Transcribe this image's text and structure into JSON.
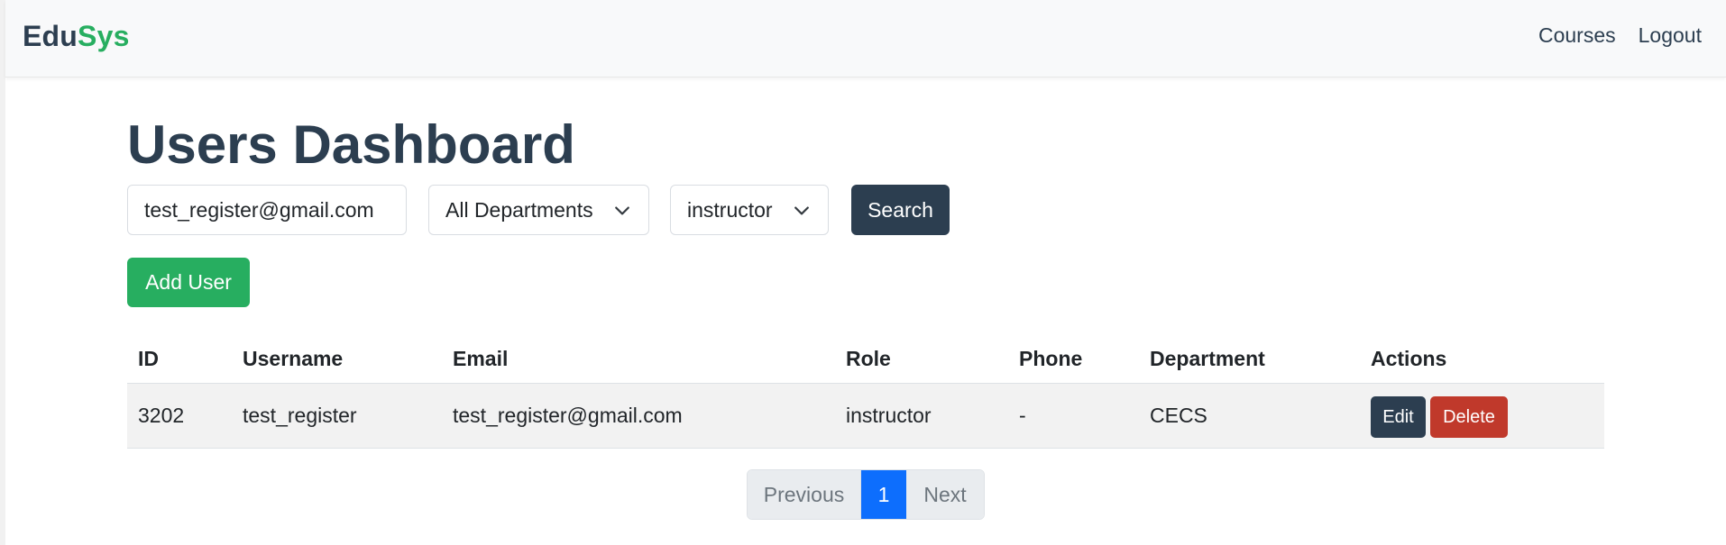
{
  "brand": {
    "part1": "Edu",
    "part2": "Sys"
  },
  "nav": {
    "courses": "Courses",
    "logout": "Logout"
  },
  "page_title": "Users Dashboard",
  "filters": {
    "email_value": "test_register@gmail.com",
    "department_selected": "All Departments",
    "role_selected": "instructor",
    "search_label": "Search"
  },
  "add_user_label": "Add User",
  "table": {
    "headers": {
      "id": "ID",
      "username": "Username",
      "email": "Email",
      "role": "Role",
      "phone": "Phone",
      "department": "Department",
      "actions": "Actions"
    },
    "rows": [
      {
        "id": "3202",
        "username": "test_register",
        "email": "test_register@gmail.com",
        "role": "instructor",
        "phone": "-",
        "department": "CECS",
        "edit": "Edit",
        "delete": "Delete"
      }
    ]
  },
  "pagination": {
    "previous": "Previous",
    "current": "1",
    "next": "Next"
  },
  "colors": {
    "primary": "#2c3e50",
    "success": "#27ae60",
    "danger": "#c0392b",
    "page_active": "#0d6efd"
  },
  "icons": {
    "select_arrow": "chevron-down-icon"
  }
}
